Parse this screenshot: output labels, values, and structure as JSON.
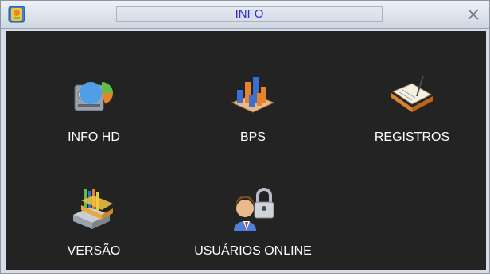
{
  "window": {
    "title": "INFO"
  },
  "tiles": [
    {
      "label": "INFO HD",
      "icon": "hard-disk-icon"
    },
    {
      "label": "BPS",
      "icon": "bar-chart-icon"
    },
    {
      "label": "REGISTROS",
      "icon": "log-book-icon"
    },
    {
      "label": "VERSÃO",
      "icon": "version-box-icon"
    },
    {
      "label": "USUÁRIOS ONLINE",
      "icon": "online-user-icon"
    }
  ],
  "colors": {
    "title_text": "#2b2bcf",
    "content_bg": "#232323",
    "label_text": "#ffffff"
  }
}
